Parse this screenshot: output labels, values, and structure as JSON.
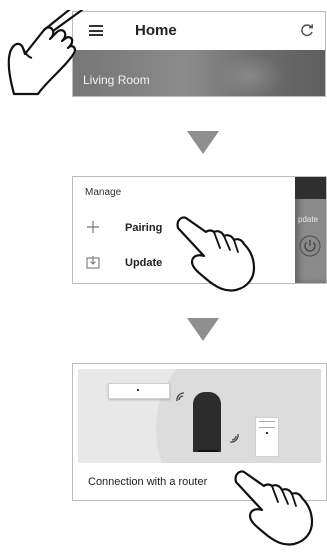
{
  "step1": {
    "title": "Home",
    "room_label": "Living Room",
    "icons": [
      "menu-icon",
      "refresh-icon"
    ]
  },
  "step2": {
    "heading": "Manage",
    "items": [
      {
        "label": "Pairing",
        "icon": "plus-icon"
      },
      {
        "label": "Update",
        "icon": "download-icon"
      }
    ],
    "partial_text": "pdate"
  },
  "step3": {
    "caption": "Connection with a router"
  },
  "colors": {
    "arrow": "#8f8f8f",
    "banner": "#7c7c7c",
    "illustration_bg": "#e8e8e8"
  }
}
